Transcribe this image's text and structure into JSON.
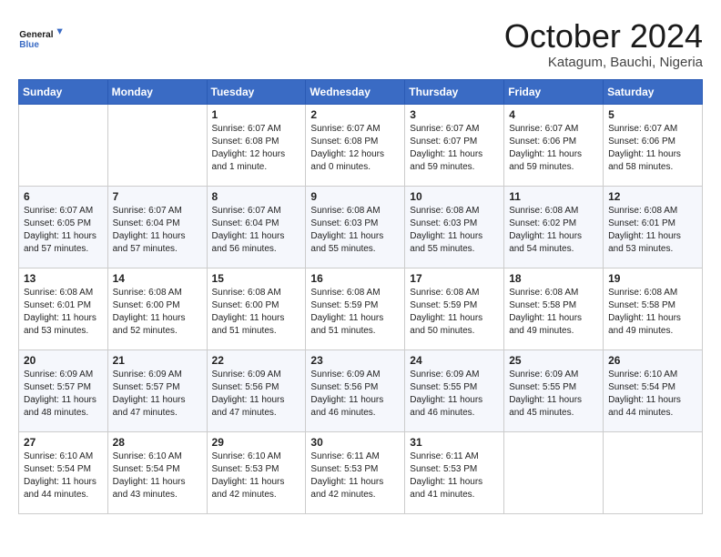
{
  "header": {
    "logo_general": "General",
    "logo_blue": "Blue",
    "month": "October 2024",
    "location": "Katagum, Bauchi, Nigeria"
  },
  "days_of_week": [
    "Sunday",
    "Monday",
    "Tuesday",
    "Wednesday",
    "Thursday",
    "Friday",
    "Saturday"
  ],
  "weeks": [
    [
      {
        "day": "",
        "content": ""
      },
      {
        "day": "",
        "content": ""
      },
      {
        "day": "1",
        "content": "Sunrise: 6:07 AM\nSunset: 6:08 PM\nDaylight: 12 hours\nand 1 minute."
      },
      {
        "day": "2",
        "content": "Sunrise: 6:07 AM\nSunset: 6:08 PM\nDaylight: 12 hours\nand 0 minutes."
      },
      {
        "day": "3",
        "content": "Sunrise: 6:07 AM\nSunset: 6:07 PM\nDaylight: 11 hours\nand 59 minutes."
      },
      {
        "day": "4",
        "content": "Sunrise: 6:07 AM\nSunset: 6:06 PM\nDaylight: 11 hours\nand 59 minutes."
      },
      {
        "day": "5",
        "content": "Sunrise: 6:07 AM\nSunset: 6:06 PM\nDaylight: 11 hours\nand 58 minutes."
      }
    ],
    [
      {
        "day": "6",
        "content": "Sunrise: 6:07 AM\nSunset: 6:05 PM\nDaylight: 11 hours\nand 57 minutes."
      },
      {
        "day": "7",
        "content": "Sunrise: 6:07 AM\nSunset: 6:04 PM\nDaylight: 11 hours\nand 57 minutes."
      },
      {
        "day": "8",
        "content": "Sunrise: 6:07 AM\nSunset: 6:04 PM\nDaylight: 11 hours\nand 56 minutes."
      },
      {
        "day": "9",
        "content": "Sunrise: 6:08 AM\nSunset: 6:03 PM\nDaylight: 11 hours\nand 55 minutes."
      },
      {
        "day": "10",
        "content": "Sunrise: 6:08 AM\nSunset: 6:03 PM\nDaylight: 11 hours\nand 55 minutes."
      },
      {
        "day": "11",
        "content": "Sunrise: 6:08 AM\nSunset: 6:02 PM\nDaylight: 11 hours\nand 54 minutes."
      },
      {
        "day": "12",
        "content": "Sunrise: 6:08 AM\nSunset: 6:01 PM\nDaylight: 11 hours\nand 53 minutes."
      }
    ],
    [
      {
        "day": "13",
        "content": "Sunrise: 6:08 AM\nSunset: 6:01 PM\nDaylight: 11 hours\nand 53 minutes."
      },
      {
        "day": "14",
        "content": "Sunrise: 6:08 AM\nSunset: 6:00 PM\nDaylight: 11 hours\nand 52 minutes."
      },
      {
        "day": "15",
        "content": "Sunrise: 6:08 AM\nSunset: 6:00 PM\nDaylight: 11 hours\nand 51 minutes."
      },
      {
        "day": "16",
        "content": "Sunrise: 6:08 AM\nSunset: 5:59 PM\nDaylight: 11 hours\nand 51 minutes."
      },
      {
        "day": "17",
        "content": "Sunrise: 6:08 AM\nSunset: 5:59 PM\nDaylight: 11 hours\nand 50 minutes."
      },
      {
        "day": "18",
        "content": "Sunrise: 6:08 AM\nSunset: 5:58 PM\nDaylight: 11 hours\nand 49 minutes."
      },
      {
        "day": "19",
        "content": "Sunrise: 6:08 AM\nSunset: 5:58 PM\nDaylight: 11 hours\nand 49 minutes."
      }
    ],
    [
      {
        "day": "20",
        "content": "Sunrise: 6:09 AM\nSunset: 5:57 PM\nDaylight: 11 hours\nand 48 minutes."
      },
      {
        "day": "21",
        "content": "Sunrise: 6:09 AM\nSunset: 5:57 PM\nDaylight: 11 hours\nand 47 minutes."
      },
      {
        "day": "22",
        "content": "Sunrise: 6:09 AM\nSunset: 5:56 PM\nDaylight: 11 hours\nand 47 minutes."
      },
      {
        "day": "23",
        "content": "Sunrise: 6:09 AM\nSunset: 5:56 PM\nDaylight: 11 hours\nand 46 minutes."
      },
      {
        "day": "24",
        "content": "Sunrise: 6:09 AM\nSunset: 5:55 PM\nDaylight: 11 hours\nand 46 minutes."
      },
      {
        "day": "25",
        "content": "Sunrise: 6:09 AM\nSunset: 5:55 PM\nDaylight: 11 hours\nand 45 minutes."
      },
      {
        "day": "26",
        "content": "Sunrise: 6:10 AM\nSunset: 5:54 PM\nDaylight: 11 hours\nand 44 minutes."
      }
    ],
    [
      {
        "day": "27",
        "content": "Sunrise: 6:10 AM\nSunset: 5:54 PM\nDaylight: 11 hours\nand 44 minutes."
      },
      {
        "day": "28",
        "content": "Sunrise: 6:10 AM\nSunset: 5:54 PM\nDaylight: 11 hours\nand 43 minutes."
      },
      {
        "day": "29",
        "content": "Sunrise: 6:10 AM\nSunset: 5:53 PM\nDaylight: 11 hours\nand 42 minutes."
      },
      {
        "day": "30",
        "content": "Sunrise: 6:11 AM\nSunset: 5:53 PM\nDaylight: 11 hours\nand 42 minutes."
      },
      {
        "day": "31",
        "content": "Sunrise: 6:11 AM\nSunset: 5:53 PM\nDaylight: 11 hours\nand 41 minutes."
      },
      {
        "day": "",
        "content": ""
      },
      {
        "day": "",
        "content": ""
      }
    ]
  ]
}
